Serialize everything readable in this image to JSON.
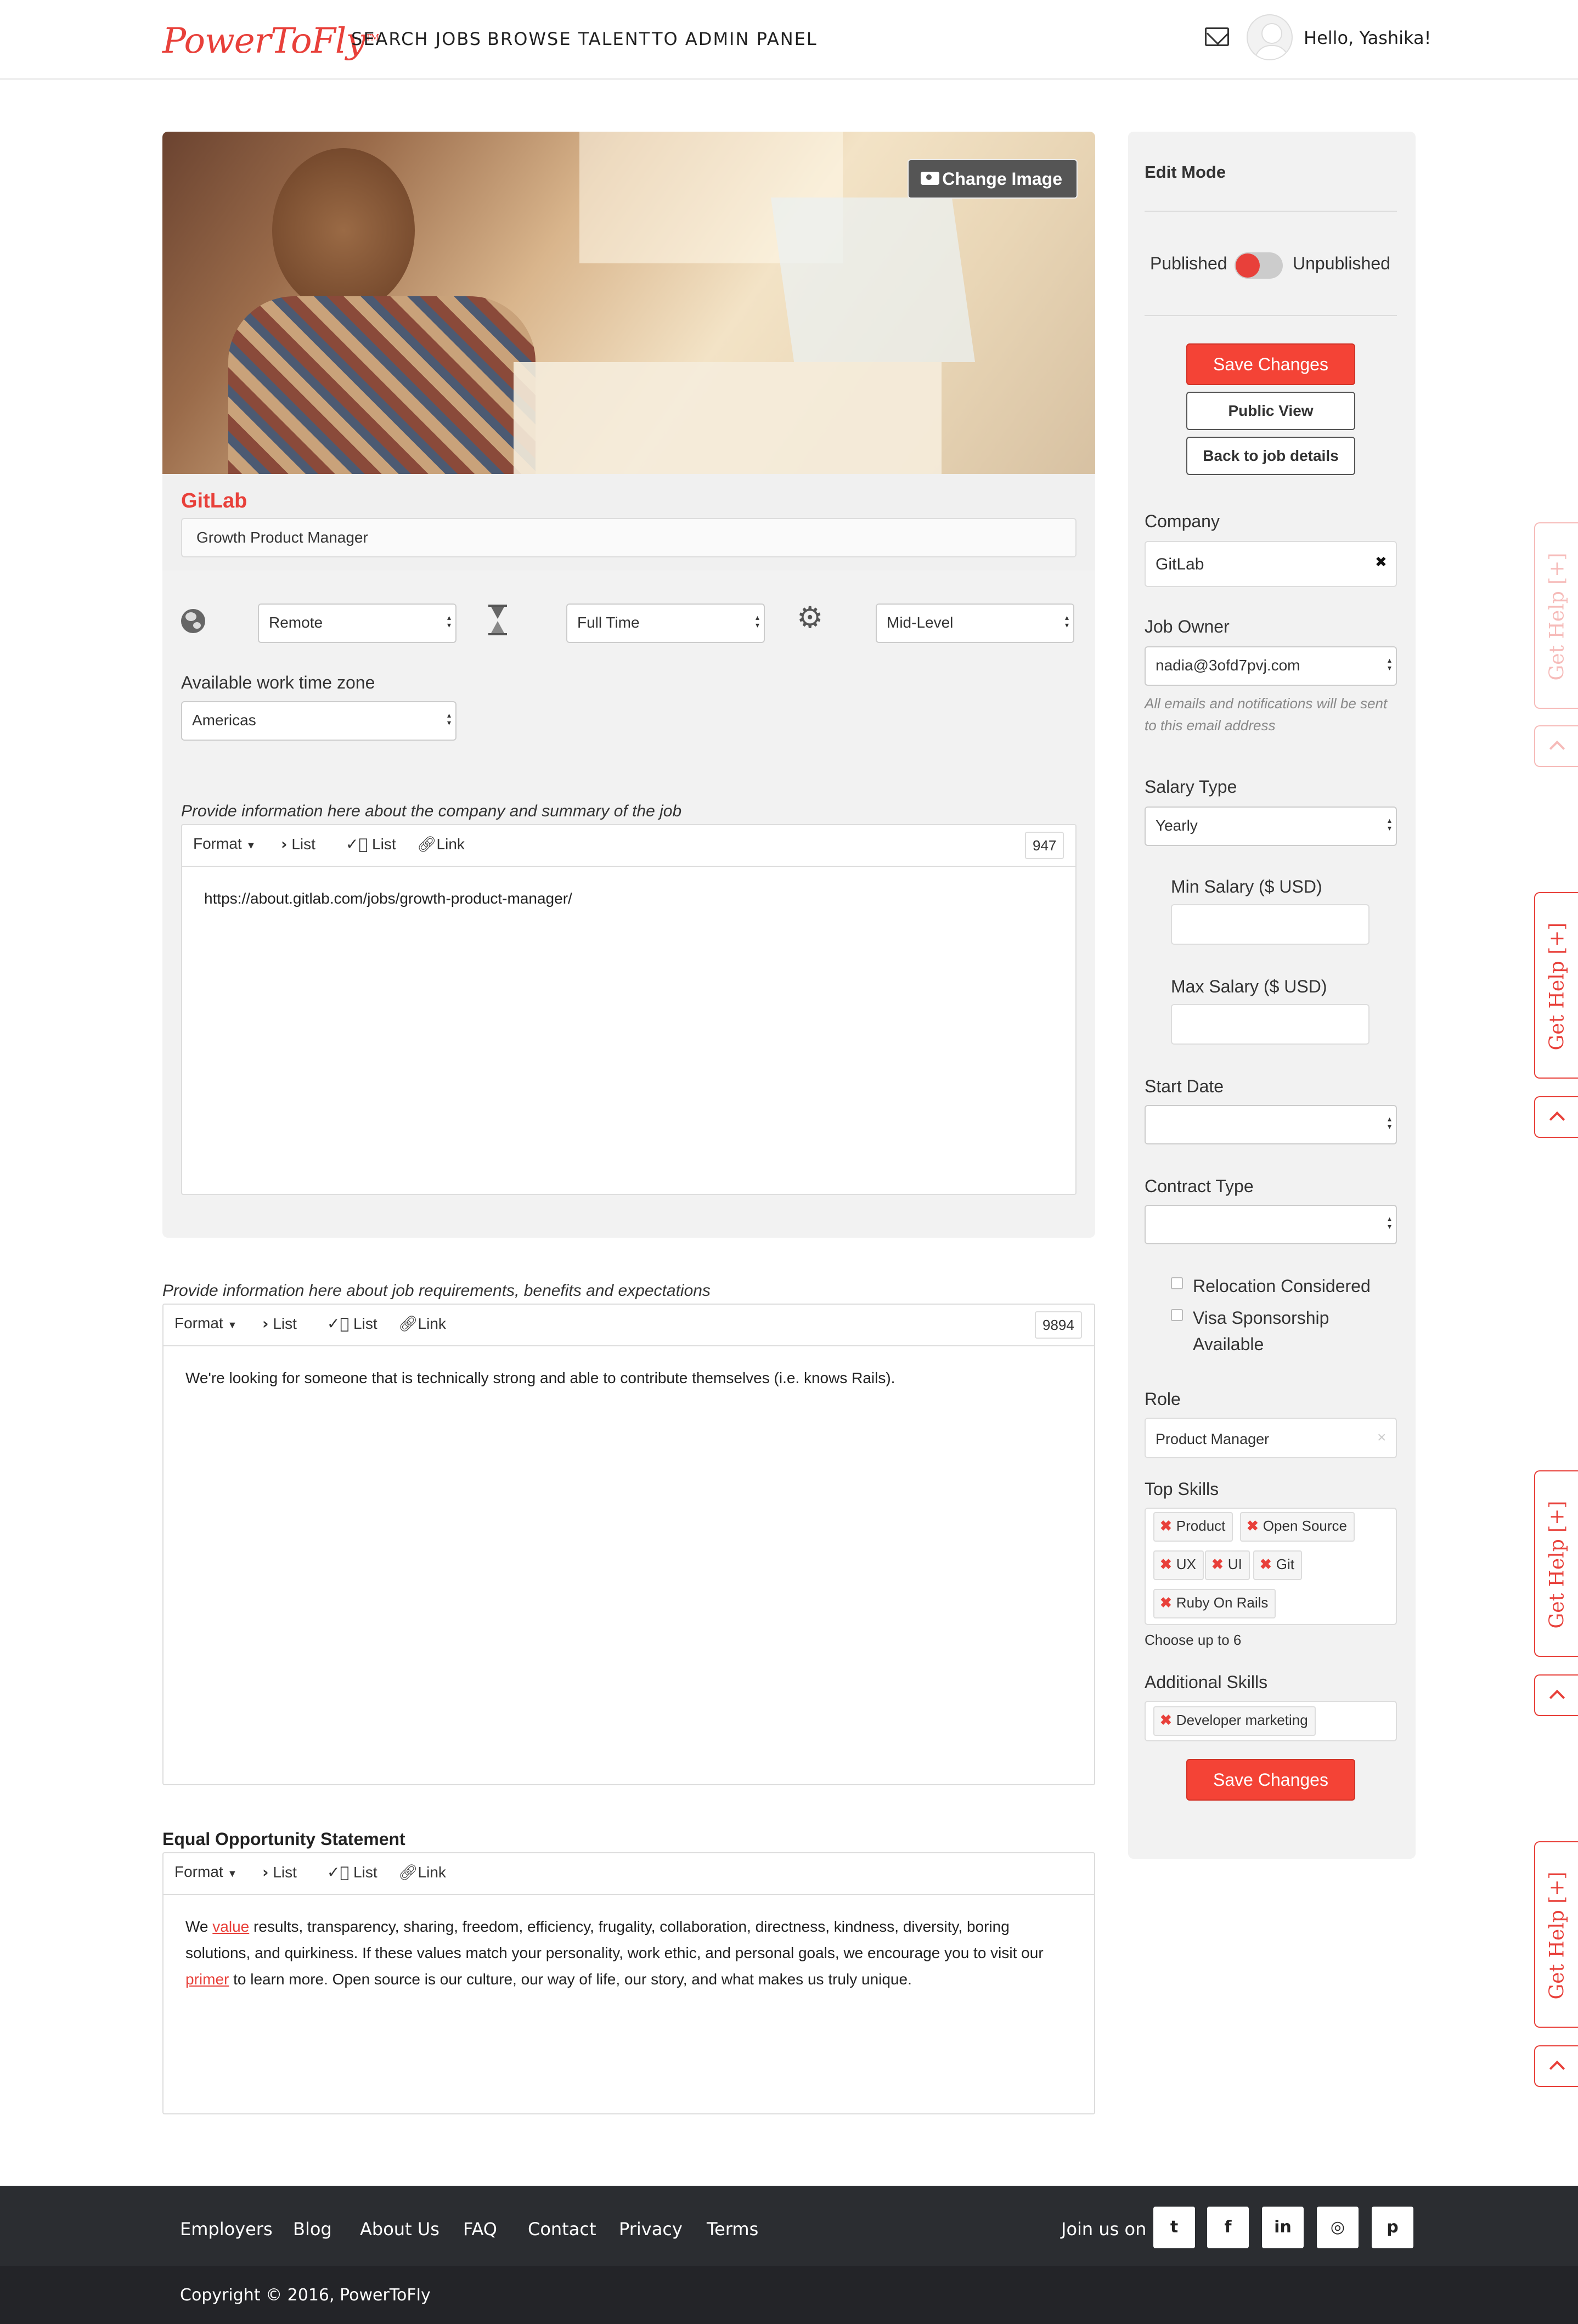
{
  "header": {
    "logo": "PowerToFly",
    "nav": [
      "SEARCH JOBS",
      "BROWSE TALENT",
      "TO ADMIN PANEL"
    ],
    "greeting": "Hello, Yashika!"
  },
  "hero": {
    "change_image_label": "Change Image",
    "company": "GitLab",
    "job_title": "Growth Product Manager"
  },
  "job": {
    "location": "Remote",
    "type": "Full Time",
    "level": "Mid-Level",
    "timezone_label": "Available work time zone",
    "timezone": "Americas"
  },
  "editors": {
    "summary": {
      "label": "Provide information here about the company and summary of the job",
      "counter": "947",
      "content": "https://about.gitlab.com/jobs/growth-product-manager/"
    },
    "requirements": {
      "label": "Provide information here about job requirements, benefits and expectations",
      "counter": "9894",
      "content": "We're looking for someone that is technically strong and able to contribute themselves (i.e. knows Rails)."
    },
    "equal_opportunity": {
      "label": "Equal Opportunity Statement",
      "content_parts": [
        "We ",
        "value",
        " results, transparency, sharing, freedom, efficiency, frugality, collaboration, directness, kindness, diversity, boring solutions, and quirkiness. If these values match your personality, work ethic, and personal goals, we encourage you to visit our ",
        "primer",
        " to learn more. Open source is our culture, our way of life, our story, and what makes us truly unique."
      ]
    },
    "toolbar": {
      "format": "Format",
      "list_bullet": "List",
      "list_numbered": "List",
      "link": "Link"
    }
  },
  "sidebar": {
    "edit_mode": "Edit Mode",
    "published": "Published",
    "unpublished": "Unpublished",
    "save_changes": "Save Changes",
    "public_view": "Public View",
    "back_to_job": "Back to job details",
    "company_label": "Company",
    "company_value": "GitLab",
    "company_clear": "✖",
    "job_owner_label": "Job Owner",
    "job_owner_value": "nadia@3ofd7pvj.com",
    "job_owner_note": "All emails and notifications will be sent to this email address",
    "salary_type_label": "Salary Type",
    "salary_type_value": "Yearly",
    "min_salary_label": "Min Salary ($ USD)",
    "max_salary_label": "Max Salary ($ USD)",
    "start_date_label": "Start Date",
    "contract_type_label": "Contract Type",
    "relocation": "Relocation Considered",
    "visa_line1": "Visa Sponsorship",
    "visa_line2": "Available",
    "role_label": "Role",
    "role_value": "Product Manager",
    "role_clear": "×",
    "top_skills_label": "Top Skills",
    "top_skills": [
      "Product",
      "Open Source",
      "UX",
      "UI",
      "Git",
      "Ruby On Rails"
    ],
    "top_skills_note": "Choose up to 6",
    "additional_skills_label": "Additional Skills",
    "additional_skills": [
      "Developer marketing"
    ]
  },
  "get_help": {
    "label": "Get Help",
    "plus": "[+]"
  },
  "footer": {
    "links": [
      "Employers",
      "Blog",
      "About Us",
      "FAQ",
      "Contact",
      "Privacy",
      "Terms"
    ],
    "join_us": "Join us on",
    "social": [
      "twitter-icon",
      "facebook-icon",
      "linkedin-icon",
      "instagram-icon",
      "pinterest-icon"
    ],
    "social_glyphs": [
      "t",
      "f",
      "in",
      "◎",
      "p"
    ],
    "copyright": "Copyright © 2016, PowerToFly"
  }
}
